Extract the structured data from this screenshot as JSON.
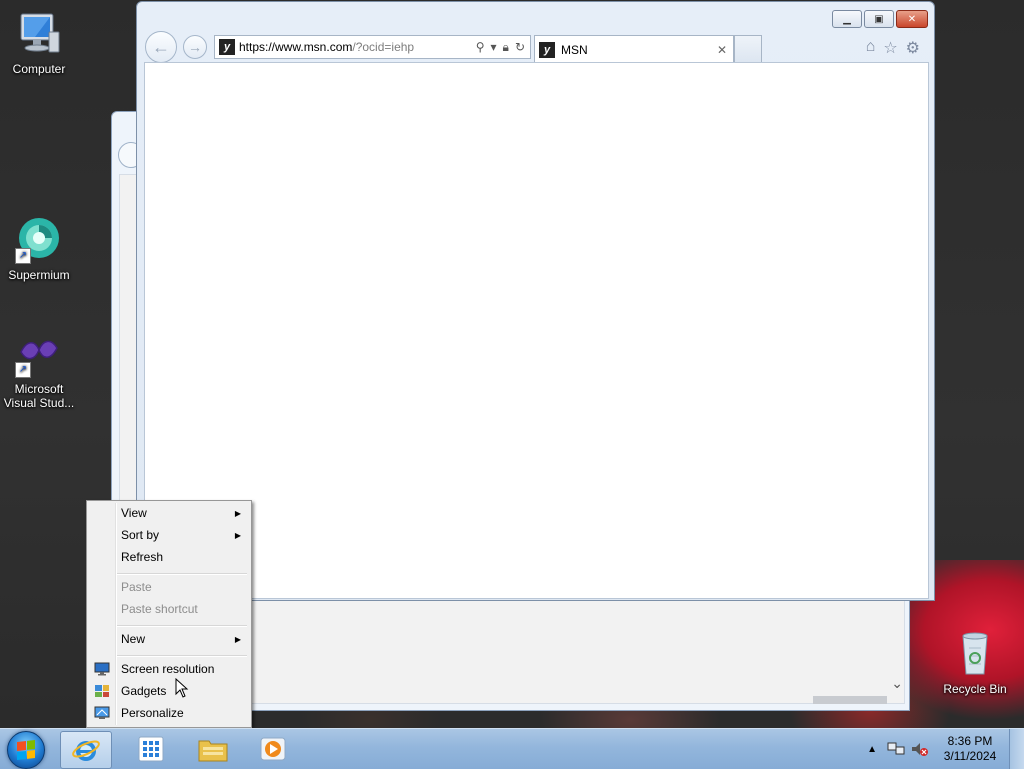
{
  "desktop": {
    "icons": [
      {
        "label": "Computer"
      },
      {
        "label": "Supermium"
      },
      {
        "label": "Microsoft Visual Stud..."
      },
      {
        "label": "Recycle Bin"
      }
    ]
  },
  "browser": {
    "address": {
      "url_host": "https://www.msn.com",
      "url_rest": "/?ocid=iehp"
    },
    "tab": {
      "title": "MSN",
      "favicon": "y"
    }
  },
  "context_menu": {
    "items": [
      {
        "label": "View",
        "has_submenu": true,
        "enabled": true
      },
      {
        "label": "Sort by",
        "has_submenu": true,
        "enabled": true
      },
      {
        "label": "Refresh",
        "has_submenu": false,
        "enabled": true
      },
      {
        "label": "Paste",
        "has_submenu": false,
        "enabled": false
      },
      {
        "label": "Paste shortcut",
        "has_submenu": false,
        "enabled": false
      },
      {
        "label": "New",
        "has_submenu": true,
        "enabled": true
      },
      {
        "label": "Screen resolution",
        "icon": "monitor-icon",
        "enabled": true
      },
      {
        "label": "Gadgets",
        "icon": "gadgets-icon",
        "enabled": true
      },
      {
        "label": "Personalize",
        "icon": "personalize-icon",
        "enabled": true
      }
    ]
  },
  "taskbar": {
    "clock": {
      "time": "8:36 PM",
      "date": "3/11/2024"
    }
  },
  "colors": {
    "accent": "#1f7ad0",
    "close_button": "#c9462c",
    "taskbar": "#93b6dc"
  }
}
